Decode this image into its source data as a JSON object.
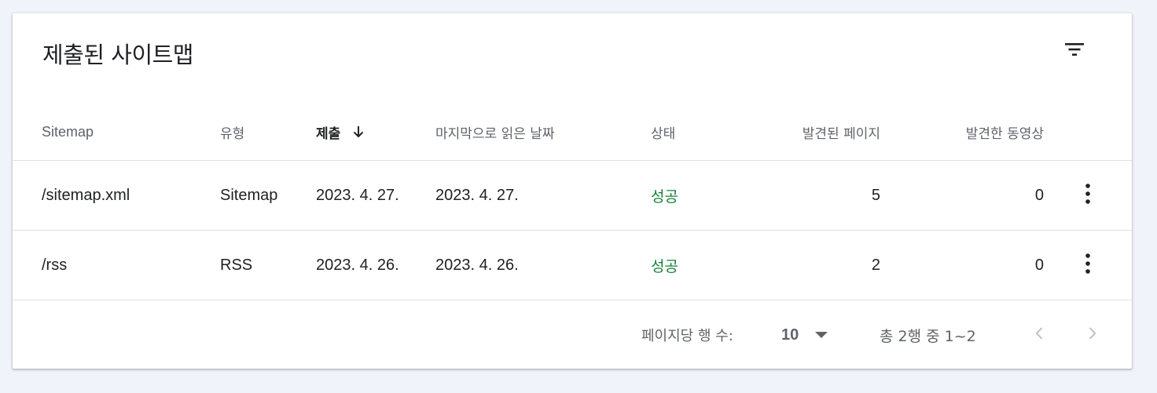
{
  "card": {
    "title": "제출된 사이트맵",
    "filter_icon": "filter-list-icon"
  },
  "table": {
    "columns": {
      "sitemap": "Sitemap",
      "type": "유형",
      "submitted": "제출",
      "last_read": "마지막으로 읽은 날짜",
      "status": "상태",
      "pages_found": "발견된 페이지",
      "videos_found": "발견한 동영상"
    },
    "sort": {
      "column": "submitted",
      "direction": "descending",
      "icon": "arrow-down-icon"
    },
    "rows": [
      {
        "sitemap": "/sitemap.xml",
        "type": "Sitemap",
        "submitted": "2023. 4. 27.",
        "last_read": "2023. 4. 27.",
        "status": "성공",
        "pages_found": "5",
        "videos_found": "0",
        "more_icon": "more-vert-icon"
      },
      {
        "sitemap": "/rss",
        "type": "RSS",
        "submitted": "2023. 4. 26.",
        "last_read": "2023. 4. 26.",
        "status": "성공",
        "pages_found": "2",
        "videos_found": "0",
        "more_icon": "more-vert-icon"
      }
    ]
  },
  "pagination": {
    "rows_per_page_label": "페이지당 행 수:",
    "rows_per_page_value": "10",
    "range_text": "총 2행 중 1~2",
    "prev_icon": "chevron-left-icon",
    "next_icon": "chevron-right-icon"
  },
  "colors": {
    "background": "#f1f3fa",
    "card": "#ffffff",
    "status_success": "#188038",
    "text_primary": "#202124",
    "text_secondary": "#5f6368",
    "nav_disabled": "#bdc1c6"
  }
}
